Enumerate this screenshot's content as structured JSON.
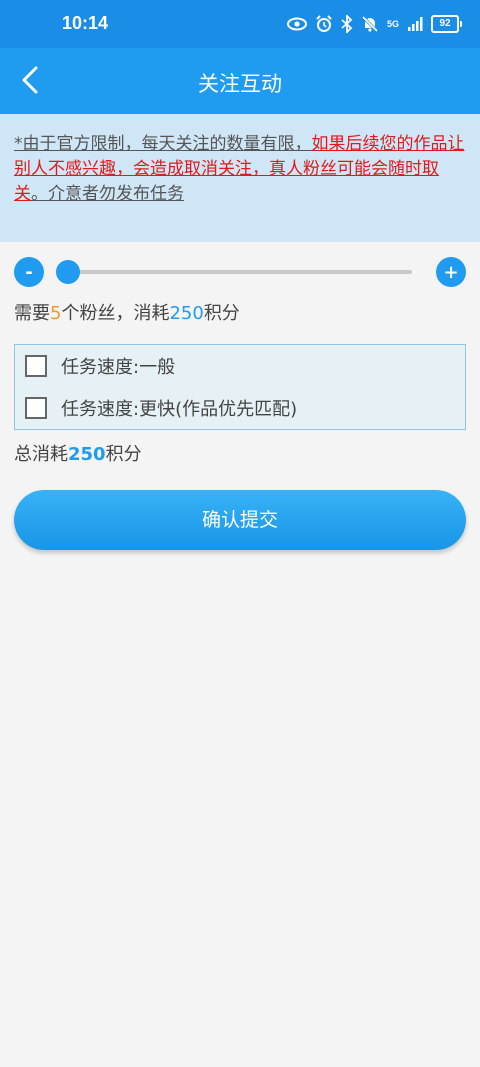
{
  "status_bar": {
    "time": "10:14",
    "battery": "92",
    "network": "5G"
  },
  "nav": {
    "title": "关注互动",
    "back_icon": "chevron-left-icon"
  },
  "notice": {
    "part1": "*由于官方限制，每天关注的数量有限，",
    "part2": "如果后续您的作品让别人不感兴趣，会造成取消关注，真人粉丝可能会随时取关",
    "part3": "。介意者勿发布任务"
  },
  "slider": {
    "minus": "-",
    "plus": "+",
    "value": 5,
    "min": 5
  },
  "need": {
    "prefix": "需要",
    "count": "5",
    "middle": "个粉丝，消耗",
    "points": "250",
    "suffix": "积分"
  },
  "speed_options": [
    {
      "label": "任务速度:一般",
      "checked": false
    },
    {
      "label": "任务速度:更快(作品优先匹配)",
      "checked": false
    }
  ],
  "total": {
    "prefix": "总消耗",
    "points": "250",
    "suffix": "积分"
  },
  "submit": {
    "label": "确认提交"
  },
  "colors": {
    "primary": "#1f9bf0",
    "accent_orange": "#f39a1e",
    "warning_red": "#e0191a",
    "notice_bg": "#cfe6f6"
  }
}
